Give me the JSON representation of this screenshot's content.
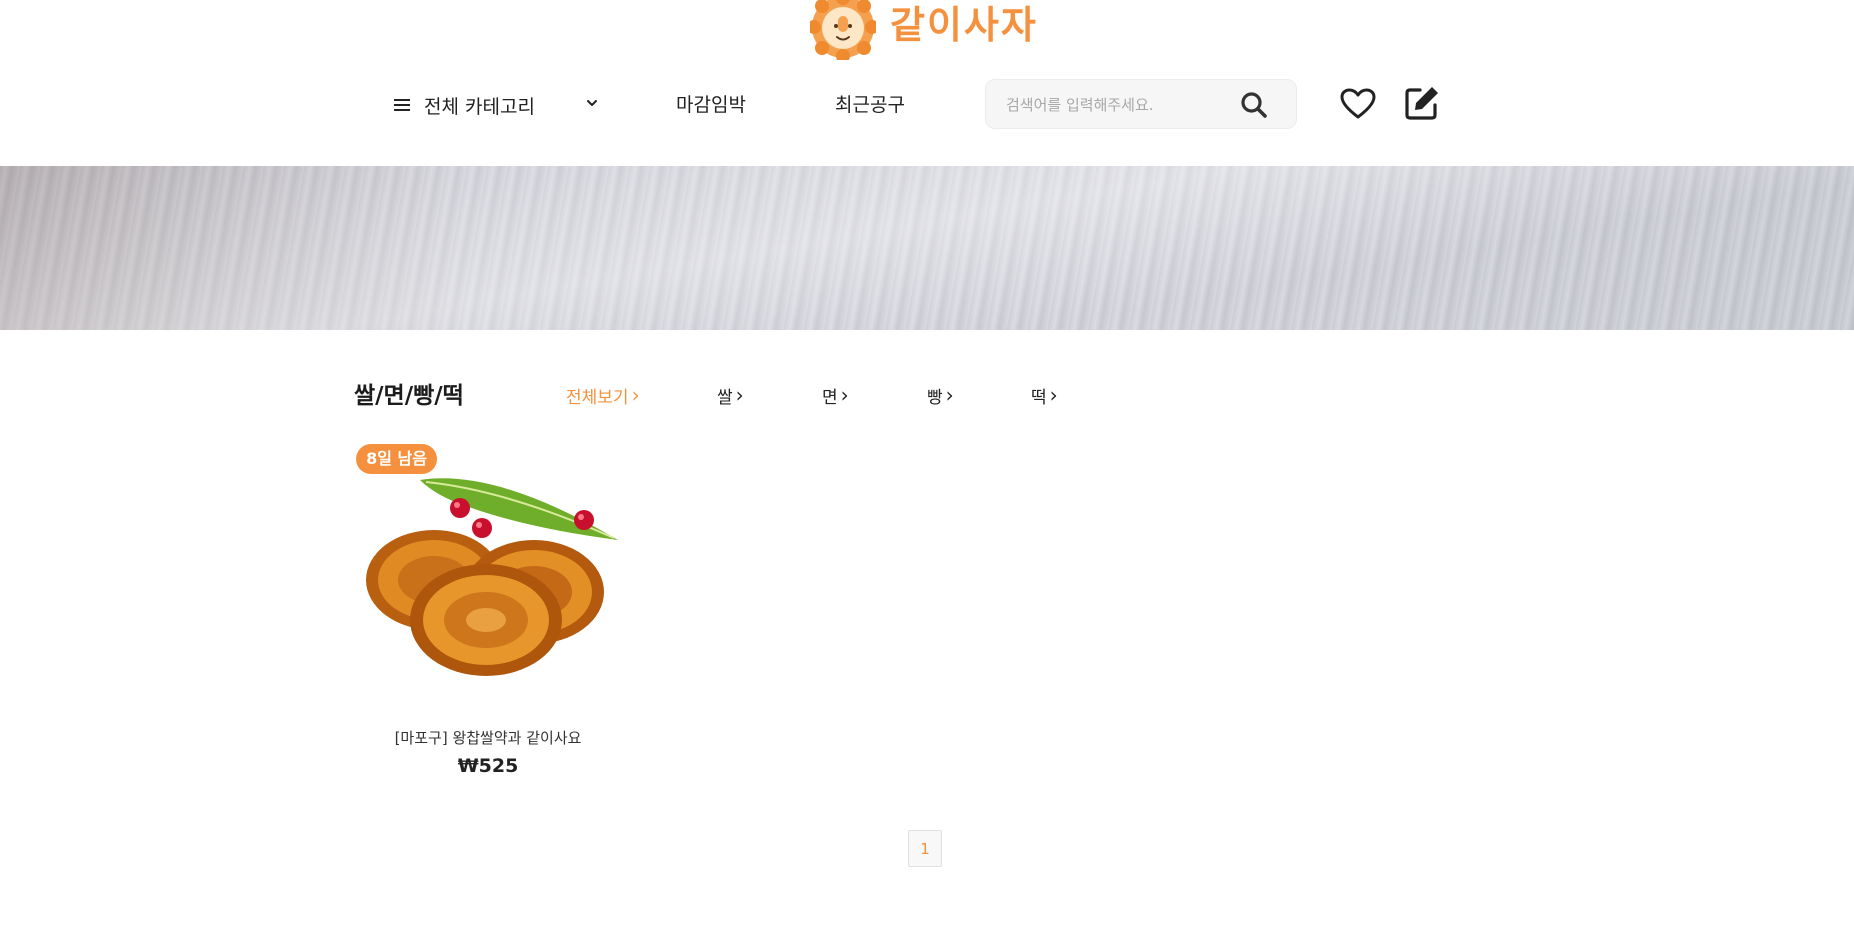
{
  "brand": {
    "name": "같이사자",
    "color": "#f5913e"
  },
  "nav": {
    "all_categories": "전체 카테고리",
    "links": [
      "마감임박",
      "최근공구"
    ]
  },
  "search": {
    "placeholder": "검색어를 입력해주세요.",
    "value": ""
  },
  "icons": {
    "wishlist": "heart-icon",
    "write": "edit-icon",
    "search": "search-icon",
    "menu": "hamburger-icon"
  },
  "category": {
    "title": "쌀/면/빵/떡",
    "subcategories": [
      {
        "label": "전체보기",
        "active": true
      },
      {
        "label": "쌀",
        "active": false
      },
      {
        "label": "면",
        "active": false
      },
      {
        "label": "빵",
        "active": false
      },
      {
        "label": "떡",
        "active": false
      }
    ]
  },
  "products": [
    {
      "badge": "8일 남음",
      "name": "[마포구] 왕찹쌀약과 같이사요",
      "price": "₩525"
    }
  ],
  "pagination": {
    "pages": [
      "1"
    ],
    "current": "1"
  }
}
